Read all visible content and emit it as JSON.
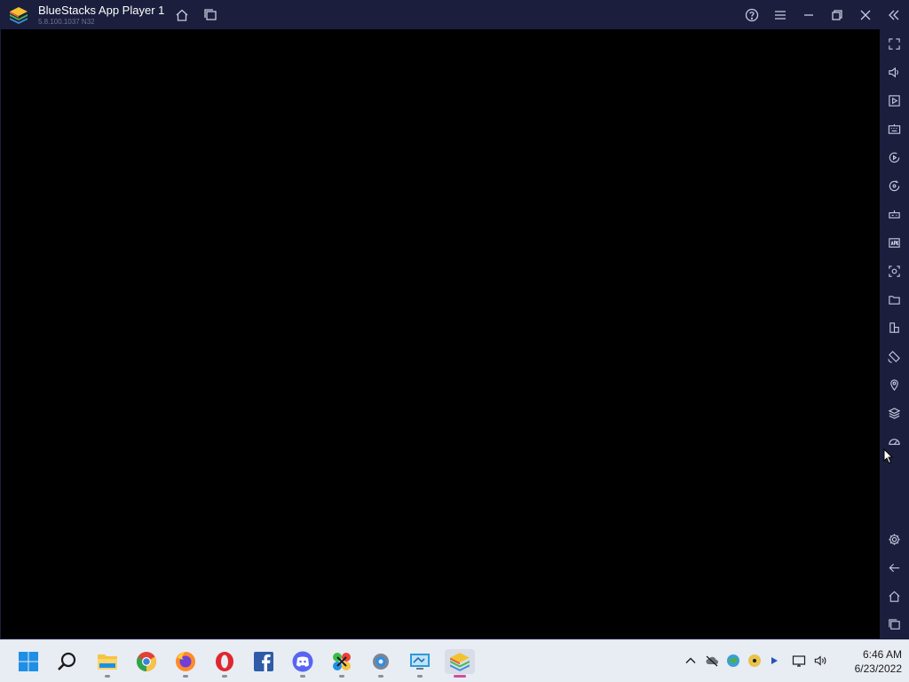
{
  "window": {
    "title": "BlueStacks App Player 1",
    "version": "5.8.100.1037 N32"
  },
  "titlebar_buttons": [
    "home-icon",
    "multi-instance-icon",
    "help-icon",
    "menu-icon",
    "minimize-icon",
    "restore-icon",
    "close-icon",
    "collapse-sidebar-icon"
  ],
  "sidebar_tools": [
    "fullscreen-icon",
    "volume-icon",
    "media-manager-icon",
    "keyboard-controls-icon",
    "macro-recorder-icon",
    "sync-icon",
    "game-controls-icon",
    "install-apk-icon",
    "screenshot-icon",
    "folder-icon",
    "multi-instance-icon",
    "rotate-icon",
    "location-icon",
    "layers-icon",
    "eco-mode-icon",
    "settings-icon",
    "back-icon",
    "home-icon",
    "recent-apps-icon"
  ],
  "taskbar": {
    "apps": [
      "start",
      "search",
      "file-explorer",
      "chrome",
      "firefox",
      "opera",
      "facebook",
      "discord",
      "app-launcher",
      "settings",
      "remote-desktop",
      "bluestacks"
    ]
  },
  "tray": [
    "chevron-up-icon",
    "cloud-icon",
    "network-globe-icon",
    "dvd-icon",
    "arrow-icon",
    "display-icon",
    "speaker-icon"
  ],
  "clock": {
    "time": "6:46 AM",
    "date": "6/23/2022"
  },
  "colors": {
    "chrome_bg": "#1b1e3d",
    "icon_stroke": "#c9cbe0",
    "taskbar_bg": "#e8ecf3",
    "active_indicator": "#cf4f9e"
  }
}
